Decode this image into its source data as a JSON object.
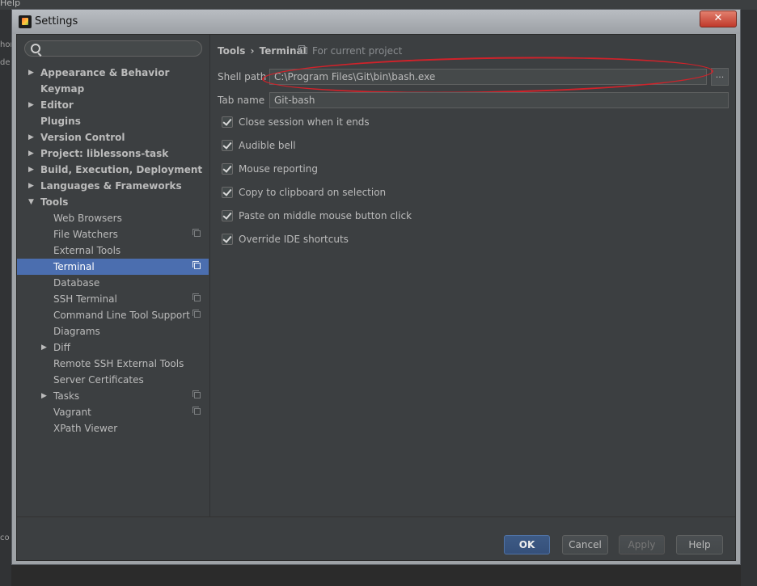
{
  "background": {
    "menu_fragment": "Help",
    "side_fragments": [
      "hor",
      "de",
      "co"
    ]
  },
  "window": {
    "title": "Settings",
    "close_glyph": "✕"
  },
  "search": {
    "placeholder": ""
  },
  "tree": [
    {
      "label": "Appearance & Behavior",
      "level": 0,
      "expander": "collapsed",
      "bold": true,
      "selected": false,
      "project": false
    },
    {
      "label": "Keymap",
      "level": 0,
      "expander": "none",
      "bold": true,
      "selected": false,
      "project": false
    },
    {
      "label": "Editor",
      "level": 0,
      "expander": "collapsed",
      "bold": true,
      "selected": false,
      "project": false
    },
    {
      "label": "Plugins",
      "level": 0,
      "expander": "none",
      "bold": true,
      "selected": false,
      "project": false
    },
    {
      "label": "Version Control",
      "level": 0,
      "expander": "collapsed",
      "bold": true,
      "selected": false,
      "project": false
    },
    {
      "label": "Project: liblessons-task",
      "level": 0,
      "expander": "collapsed",
      "bold": true,
      "selected": false,
      "project": false
    },
    {
      "label": "Build, Execution, Deployment",
      "level": 0,
      "expander": "collapsed",
      "bold": true,
      "selected": false,
      "project": false
    },
    {
      "label": "Languages & Frameworks",
      "level": 0,
      "expander": "collapsed",
      "bold": true,
      "selected": false,
      "project": false
    },
    {
      "label": "Tools",
      "level": 0,
      "expander": "expanded",
      "bold": true,
      "selected": false,
      "project": false
    },
    {
      "label": "Web Browsers",
      "level": 1,
      "expander": "none",
      "bold": false,
      "selected": false,
      "project": false
    },
    {
      "label": "File Watchers",
      "level": 1,
      "expander": "none",
      "bold": false,
      "selected": false,
      "project": true
    },
    {
      "label": "External Tools",
      "level": 1,
      "expander": "none",
      "bold": false,
      "selected": false,
      "project": false
    },
    {
      "label": "Terminal",
      "level": 1,
      "expander": "none",
      "bold": false,
      "selected": true,
      "project": true
    },
    {
      "label": "Database",
      "level": 1,
      "expander": "none",
      "bold": false,
      "selected": false,
      "project": false
    },
    {
      "label": "SSH Terminal",
      "level": 1,
      "expander": "none",
      "bold": false,
      "selected": false,
      "project": true
    },
    {
      "label": "Command Line Tool Support",
      "level": 1,
      "expander": "none",
      "bold": false,
      "selected": false,
      "project": true
    },
    {
      "label": "Diagrams",
      "level": 1,
      "expander": "none",
      "bold": false,
      "selected": false,
      "project": false
    },
    {
      "label": "Diff",
      "level": 1,
      "expander": "collapsed",
      "bold": false,
      "selected": false,
      "project": false
    },
    {
      "label": "Remote SSH External Tools",
      "level": 1,
      "expander": "none",
      "bold": false,
      "selected": false,
      "project": false
    },
    {
      "label": "Server Certificates",
      "level": 1,
      "expander": "none",
      "bold": false,
      "selected": false,
      "project": false
    },
    {
      "label": "Tasks",
      "level": 1,
      "expander": "collapsed",
      "bold": false,
      "selected": false,
      "project": true
    },
    {
      "label": "Vagrant",
      "level": 1,
      "expander": "none",
      "bold": false,
      "selected": false,
      "project": true
    },
    {
      "label": "XPath Viewer",
      "level": 1,
      "expander": "none",
      "bold": false,
      "selected": false,
      "project": false
    }
  ],
  "breadcrumb": {
    "parent": "Tools",
    "separator": "›",
    "current": "Terminal",
    "scope": "For current project"
  },
  "form": {
    "shell_path": {
      "label": "Shell path",
      "value": "C:\\Program Files\\Git\\bin\\bash.exe",
      "browse": "..."
    },
    "tab_name": {
      "label": "Tab name",
      "value": "Git-bash"
    }
  },
  "options": [
    {
      "label": "Close session when it ends",
      "checked": true
    },
    {
      "label": "Audible bell",
      "checked": true
    },
    {
      "label": "Mouse reporting",
      "checked": true
    },
    {
      "label": "Copy to clipboard on selection",
      "checked": true
    },
    {
      "label": "Paste on middle mouse button click",
      "checked": true
    },
    {
      "label": "Override IDE shortcuts",
      "checked": true
    }
  ],
  "buttons": {
    "ok": "OK",
    "cancel": "Cancel",
    "apply": "Apply",
    "help": "Help"
  },
  "annotation": {
    "color": "#d1222a"
  }
}
